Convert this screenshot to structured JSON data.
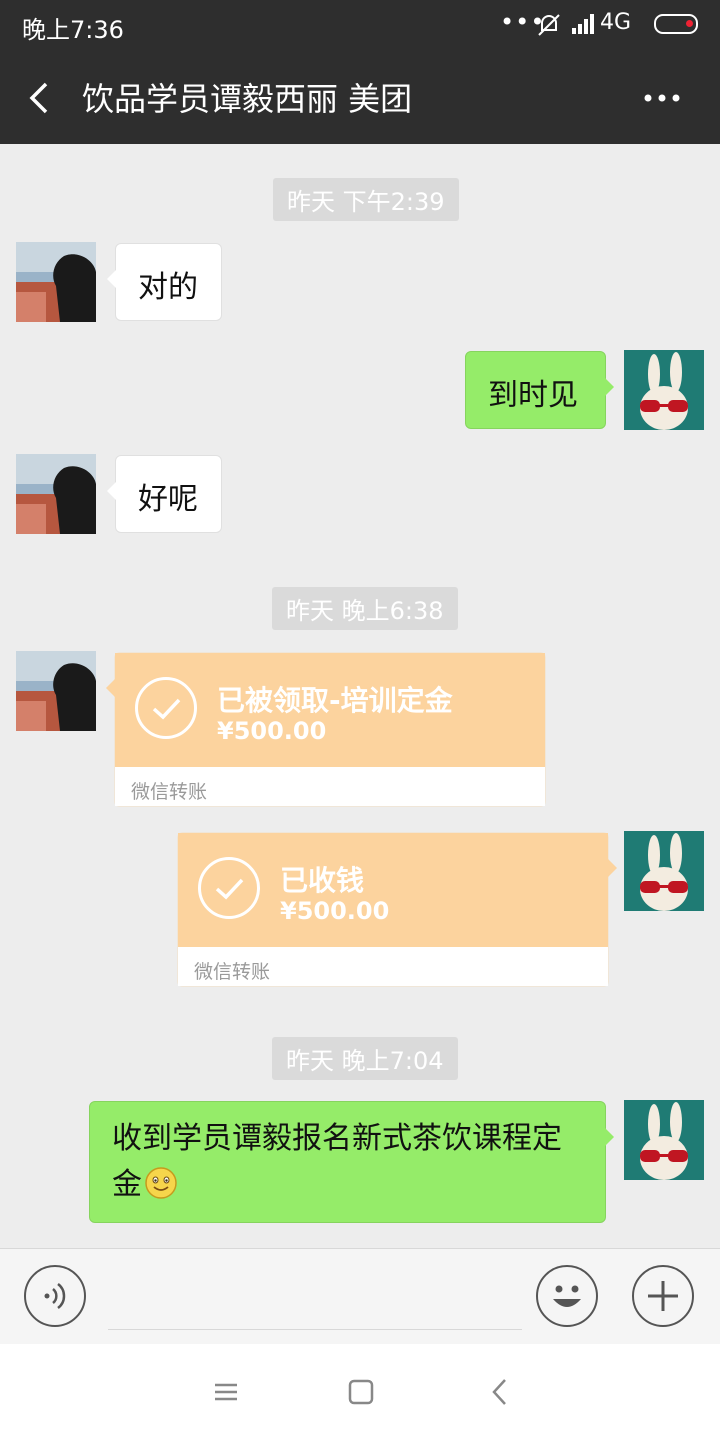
{
  "status_bar": {
    "time": "晚上7:36",
    "dots": "•••",
    "network": "4G"
  },
  "header": {
    "title": "饮品学员谭毅西丽 美团"
  },
  "messages": [
    {
      "type": "time",
      "text": "昨天 下午2:39"
    },
    {
      "type": "text",
      "side": "left",
      "text": "对的"
    },
    {
      "type": "text",
      "side": "right",
      "text": "到时见"
    },
    {
      "type": "text",
      "side": "left",
      "text": "好呢"
    },
    {
      "type": "time",
      "text": "昨天 晚上6:38"
    },
    {
      "type": "transfer",
      "side": "left",
      "title": "已被领取-培训定金",
      "amount": "¥500.00",
      "label": "微信转账"
    },
    {
      "type": "transfer",
      "side": "right",
      "title": "已收钱",
      "amount": "¥500.00",
      "label": "微信转账"
    },
    {
      "type": "time",
      "text": "昨天 晚上7:04"
    },
    {
      "type": "text",
      "side": "right",
      "text_line1": "收到学员谭毅报名新式茶饮课程定",
      "text_line2": "金"
    }
  ],
  "input": {
    "placeholder": ""
  },
  "colors": {
    "header_bg": "#2e2e2e",
    "chat_bg": "#ededed",
    "bubble_green": "#95ec69",
    "transfer_orange": "#fcd39e"
  },
  "icons": [
    "back-arrow-icon",
    "more-icon",
    "voice-icon",
    "emoji-icon",
    "plus-icon",
    "menu-icon",
    "home-icon",
    "back-icon",
    "smile-emoji-icon",
    "check-icon"
  ]
}
